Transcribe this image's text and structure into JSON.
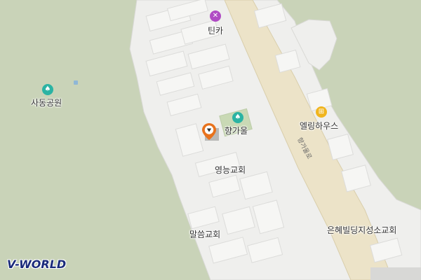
{
  "map": {
    "logo_text": "V-WORLD",
    "road_label": "향가울로",
    "pois": [
      {
        "id": "park",
        "name": "사동공원",
        "icon": "park-icon",
        "color": "#2bb3a3"
      },
      {
        "id": "tinka",
        "name": "틴카",
        "icon": "repair-tools-icon",
        "color": "#b04bc4"
      },
      {
        "id": "hyanggaul",
        "name": "향가울",
        "icon": "park-icon",
        "color": "#2bb3a3"
      },
      {
        "id": "elring",
        "name": "엘링하우스",
        "icon": "restaurant-icon",
        "color": "#f0b51e"
      },
      {
        "id": "yeongneung",
        "name": "영능교회",
        "icon": "",
        "color": ""
      },
      {
        "id": "malsseum",
        "name": "말씀교회",
        "icon": "",
        "color": ""
      },
      {
        "id": "eunhye",
        "name": "은혜빌딩지성소교회",
        "icon": "",
        "color": ""
      }
    ],
    "marker": {
      "icon": "location-pin-icon",
      "color": "#e8721c"
    }
  }
}
